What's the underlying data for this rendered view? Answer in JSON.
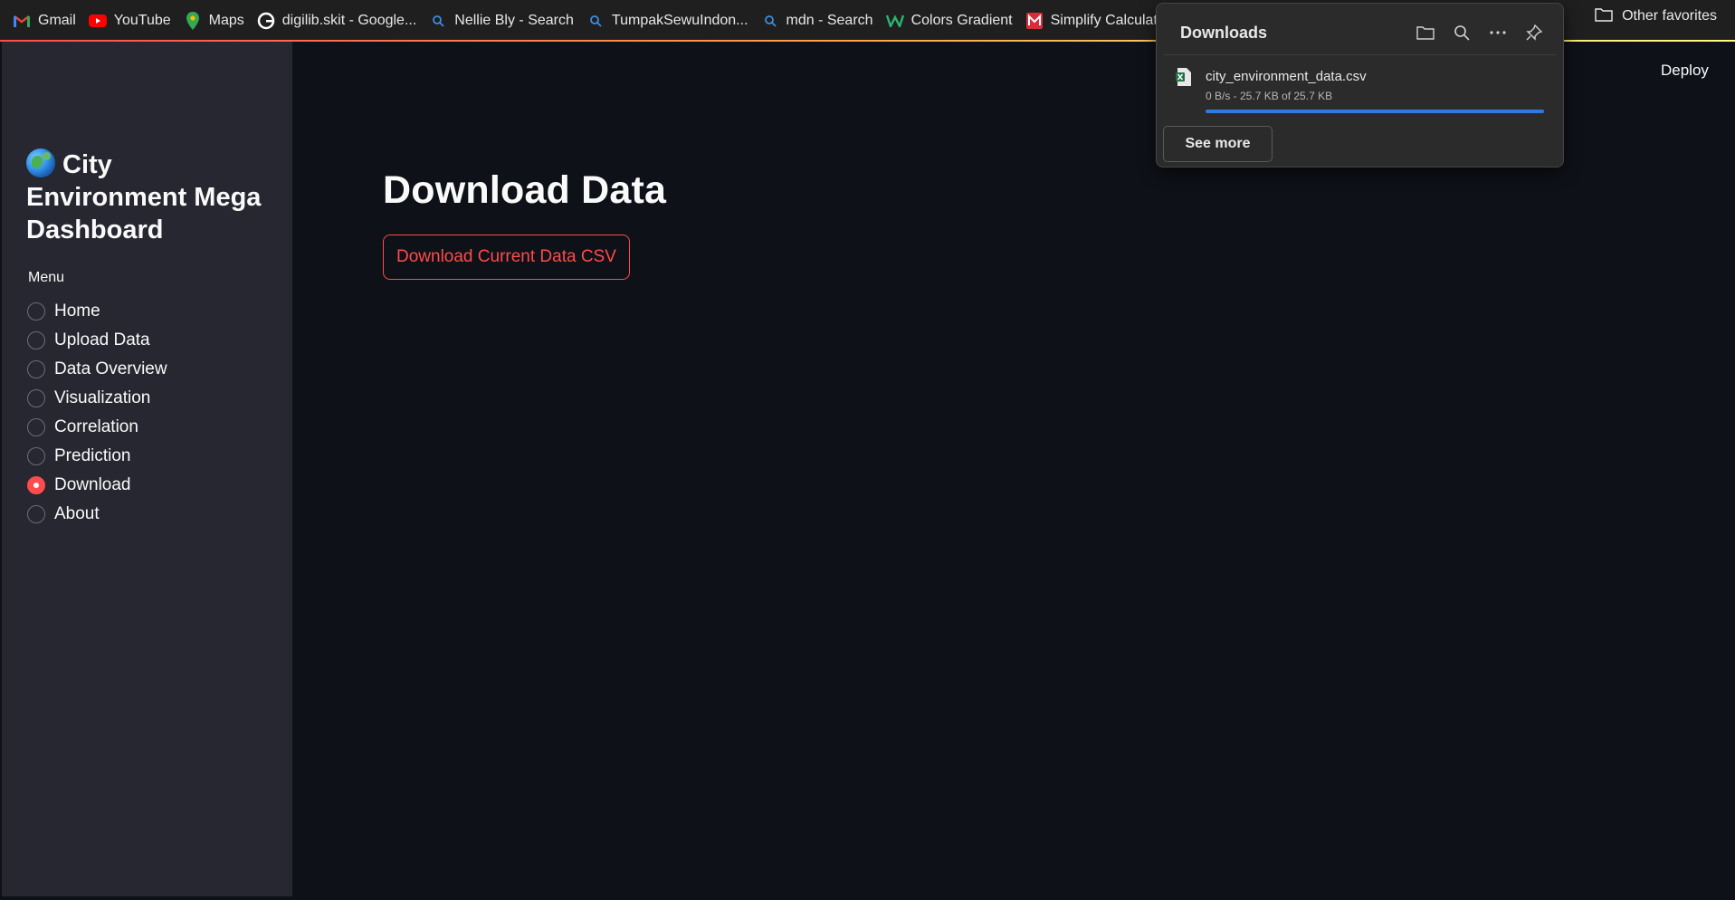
{
  "bookmarks": {
    "items": [
      {
        "label": "Gmail",
        "icon": "gmail-icon"
      },
      {
        "label": "YouTube",
        "icon": "youtube-icon"
      },
      {
        "label": "Maps",
        "icon": "maps-icon"
      },
      {
        "label": "digilib.skit - Google...",
        "icon": "google-icon"
      },
      {
        "label": "Nellie Bly - Search",
        "icon": "search-icon"
      },
      {
        "label": "TumpakSewuIndon...",
        "icon": "search-icon"
      },
      {
        "label": "mdn - Search",
        "icon": "search-icon"
      },
      {
        "label": "Colors Gradient",
        "icon": "w-icon"
      },
      {
        "label": "Simplify Calculato",
        "icon": "calculator-icon"
      }
    ],
    "other_favorites": "Other favorites"
  },
  "sidebar": {
    "title": "City Environment Mega Dashboard",
    "menu_label": "Menu",
    "items": [
      {
        "label": "Home",
        "selected": false
      },
      {
        "label": "Upload Data",
        "selected": false
      },
      {
        "label": "Data Overview",
        "selected": false
      },
      {
        "label": "Visualization",
        "selected": false
      },
      {
        "label": "Correlation",
        "selected": false
      },
      {
        "label": "Prediction",
        "selected": false
      },
      {
        "label": "Download",
        "selected": true
      },
      {
        "label": "About",
        "selected": false
      }
    ]
  },
  "header": {
    "deploy_label": "Deploy"
  },
  "main": {
    "title": "Download Data",
    "download_button": "Download Current Data CSV"
  },
  "downloads_panel": {
    "title": "Downloads",
    "file_name": "city_environment_data.csv",
    "status": "0 B/s - 25.7 KB of 25.7 KB",
    "progress": 1.0,
    "see_more": "See more"
  },
  "colors": {
    "accent": "#ff4b4b",
    "sidebar_bg": "#262730",
    "main_bg": "#0e1117",
    "progress": "#2f79e0"
  }
}
